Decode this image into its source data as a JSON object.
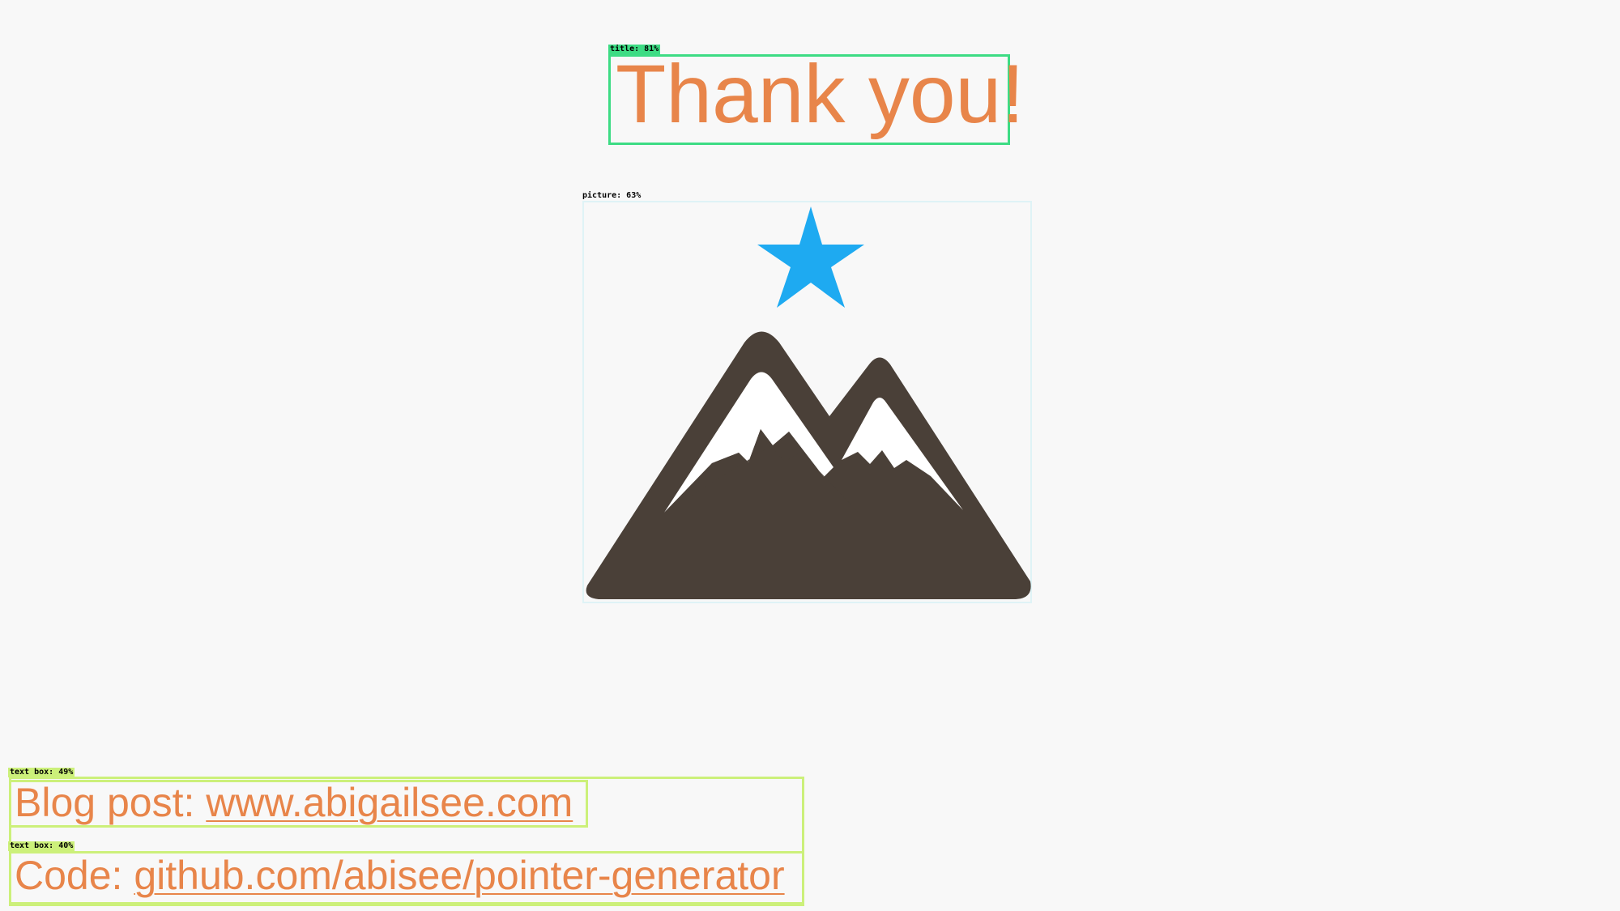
{
  "detections": {
    "title": "title: 81%",
    "picture": "picture: 63%",
    "text_box_1": "text box: 49%",
    "text_box_2": "text box: 40%"
  },
  "slide": {
    "title": "Thank you!",
    "blog_prefix": "Blog post: ",
    "blog_link": "www.abigailsee.com",
    "code_prefix": "Code: ",
    "code_link": "github.com/abisee/pointer-generator"
  },
  "icons": {
    "picture": "mountain-with-star-icon"
  },
  "colors": {
    "text_accent": "#e8854a",
    "title_box": "#3ddc84",
    "text_box": "#ccf07a",
    "star": "#1eaaf1",
    "mountain": "#4a4038",
    "snow": "#ffffff"
  }
}
